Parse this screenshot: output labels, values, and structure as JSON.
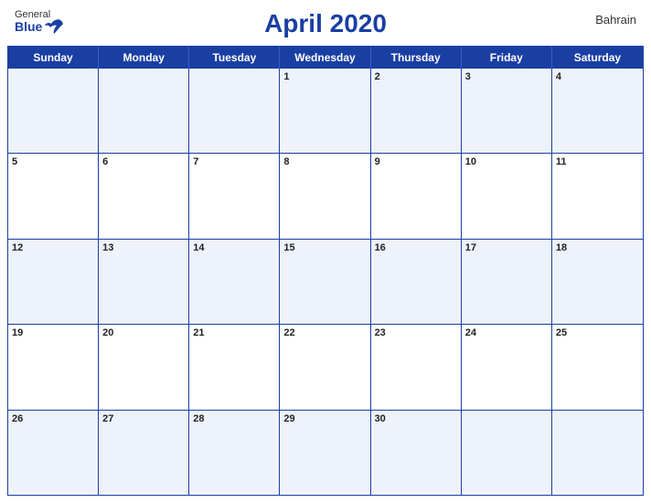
{
  "header": {
    "title": "April 2020",
    "country": "Bahrain",
    "logo_general": "General",
    "logo_blue": "Blue"
  },
  "days_of_week": [
    "Sunday",
    "Monday",
    "Tuesday",
    "Wednesday",
    "Thursday",
    "Friday",
    "Saturday"
  ],
  "weeks": [
    [
      null,
      null,
      null,
      1,
      2,
      3,
      4
    ],
    [
      5,
      6,
      7,
      8,
      9,
      10,
      11
    ],
    [
      12,
      13,
      14,
      15,
      16,
      17,
      18
    ],
    [
      19,
      20,
      21,
      22,
      23,
      24,
      25
    ],
    [
      26,
      27,
      28,
      29,
      30,
      null,
      null
    ]
  ],
  "colors": {
    "header_bg": "#1a3fa3",
    "border": "#1a3fa3",
    "title": "#1a3fa3",
    "odd_row_bg": "#eef2fb",
    "even_row_bg": "#ffffff"
  }
}
